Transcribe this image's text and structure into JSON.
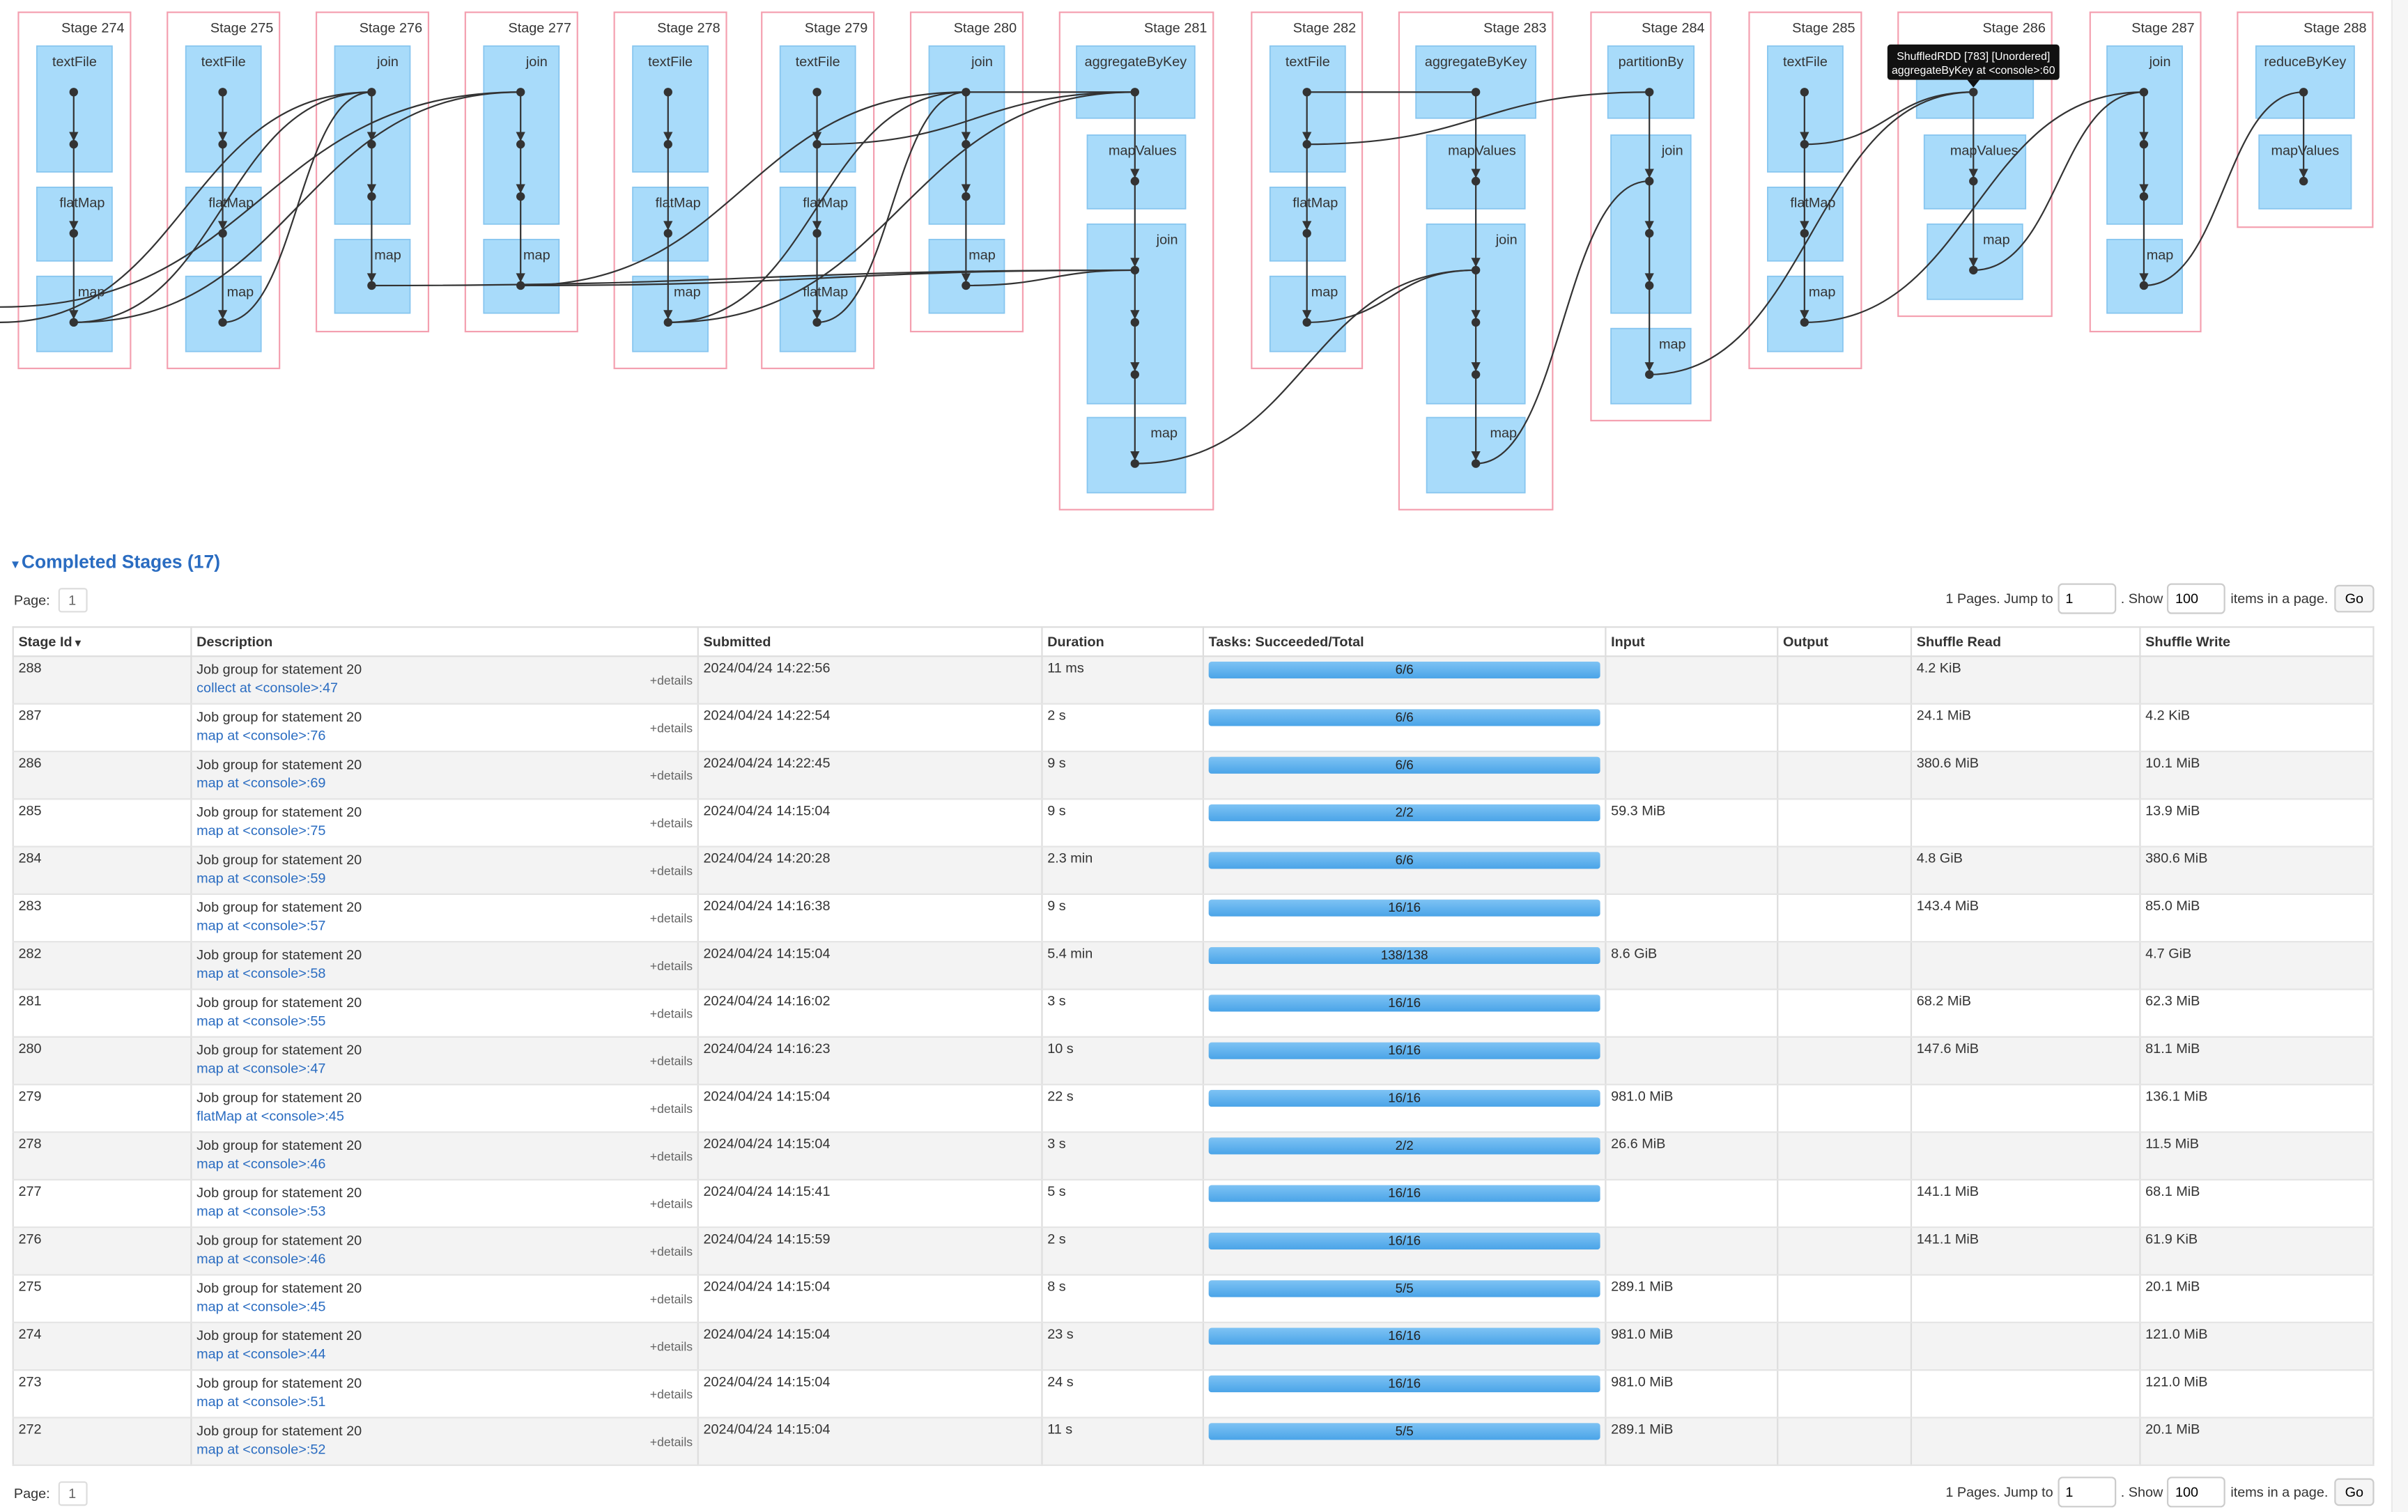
{
  "dag": {
    "stages": [
      {
        "label": "Stage 274",
        "rdds": [
          "textFile",
          "flatMap",
          "map"
        ]
      },
      {
        "label": "Stage 275",
        "rdds": [
          "textFile",
          "flatMap",
          "map"
        ]
      },
      {
        "label": "Stage 276",
        "rdds": [
          "join",
          "map"
        ]
      },
      {
        "label": "Stage 277",
        "rdds": [
          "join",
          "map"
        ]
      },
      {
        "label": "Stage 278",
        "rdds": [
          "textFile",
          "flatMap",
          "map"
        ]
      },
      {
        "label": "Stage 279",
        "rdds": [
          "textFile",
          "flatMap",
          "flatMap"
        ]
      },
      {
        "label": "Stage 280",
        "rdds": [
          "join",
          "map"
        ]
      },
      {
        "label": "Stage 281",
        "rdds": [
          "aggregateByKey",
          "mapValues",
          "join",
          "map"
        ]
      },
      {
        "label": "Stage 282",
        "rdds": [
          "textFile",
          "flatMap",
          "map"
        ]
      },
      {
        "label": "Stage 283",
        "rdds": [
          "aggregateByKey",
          "mapValues",
          "join",
          "map"
        ]
      },
      {
        "label": "Stage 284",
        "rdds": [
          "partitionBy",
          "join",
          "map"
        ]
      },
      {
        "label": "Stage 285",
        "rdds": [
          "textFile",
          "flatMap",
          "map"
        ]
      },
      {
        "label": "Stage 286",
        "rdds": [
          "",
          "mapValues",
          "map"
        ]
      },
      {
        "label": "Stage 287",
        "rdds": [
          "join",
          "map"
        ]
      },
      {
        "label": "Stage 288",
        "rdds": [
          "reduceByKey",
          "mapValues"
        ]
      }
    ],
    "tooltip": {
      "line1": "ShuffledRDD [783] [Unordered]",
      "line2": "aggregateByKey at <console>:60"
    }
  },
  "section": {
    "title": "Completed Stages (17)"
  },
  "pagination": {
    "page_label": "Page:",
    "current_page": "1",
    "pages_text": "1 Pages. Jump to",
    "jump_value": "1",
    "show_text": ". Show",
    "show_value": "100",
    "items_text": "items in a page.",
    "go_label": "Go"
  },
  "table": {
    "headers": [
      "Stage Id",
      "Description",
      "Submitted",
      "Duration",
      "Tasks: Succeeded/Total",
      "Input",
      "Output",
      "Shuffle Read",
      "Shuffle Write"
    ],
    "sort_indicator": "▾",
    "details_label": "+details",
    "rows": [
      {
        "id": "288",
        "job": "Job group for statement 20",
        "link": "collect at <console>:47",
        "submitted": "2024/04/24 14:22:56",
        "duration": "11 ms",
        "tasks": "6/6",
        "progress": 1,
        "input": "",
        "output": "",
        "shuffle_read": "4.2 KiB",
        "shuffle_write": ""
      },
      {
        "id": "287",
        "job": "Job group for statement 20",
        "link": "map at <console>:76",
        "submitted": "2024/04/24 14:22:54",
        "duration": "2 s",
        "tasks": "6/6",
        "progress": 1,
        "input": "",
        "output": "",
        "shuffle_read": "24.1 MiB",
        "shuffle_write": "4.2 KiB"
      },
      {
        "id": "286",
        "job": "Job group for statement 20",
        "link": "map at <console>:69",
        "submitted": "2024/04/24 14:22:45",
        "duration": "9 s",
        "tasks": "6/6",
        "progress": 1,
        "input": "",
        "output": "",
        "shuffle_read": "380.6 MiB",
        "shuffle_write": "10.1 MiB"
      },
      {
        "id": "285",
        "job": "Job group for statement 20",
        "link": "map at <console>:75",
        "submitted": "2024/04/24 14:15:04",
        "duration": "9 s",
        "tasks": "2/2",
        "progress": 1,
        "input": "59.3 MiB",
        "output": "",
        "shuffle_read": "",
        "shuffle_write": "13.9 MiB"
      },
      {
        "id": "284",
        "job": "Job group for statement 20",
        "link": "map at <console>:59",
        "submitted": "2024/04/24 14:20:28",
        "duration": "2.3 min",
        "tasks": "6/6",
        "progress": 1,
        "input": "",
        "output": "",
        "shuffle_read": "4.8 GiB",
        "shuffle_write": "380.6 MiB"
      },
      {
        "id": "283",
        "job": "Job group for statement 20",
        "link": "map at <console>:57",
        "submitted": "2024/04/24 14:16:38",
        "duration": "9 s",
        "tasks": "16/16",
        "progress": 1,
        "input": "",
        "output": "",
        "shuffle_read": "143.4 MiB",
        "shuffle_write": "85.0 MiB"
      },
      {
        "id": "282",
        "job": "Job group for statement 20",
        "link": "map at <console>:58",
        "submitted": "2024/04/24 14:15:04",
        "duration": "5.4 min",
        "tasks": "138/138",
        "progress": 1,
        "input": "8.6 GiB",
        "output": "",
        "shuffle_read": "",
        "shuffle_write": "4.7 GiB"
      },
      {
        "id": "281",
        "job": "Job group for statement 20",
        "link": "map at <console>:55",
        "submitted": "2024/04/24 14:16:02",
        "duration": "3 s",
        "tasks": "16/16",
        "progress": 1,
        "input": "",
        "output": "",
        "shuffle_read": "68.2 MiB",
        "shuffle_write": "62.3 MiB"
      },
      {
        "id": "280",
        "job": "Job group for statement 20",
        "link": "map at <console>:47",
        "submitted": "2024/04/24 14:16:23",
        "duration": "10 s",
        "tasks": "16/16",
        "progress": 1,
        "input": "",
        "output": "",
        "shuffle_read": "147.6 MiB",
        "shuffle_write": "81.1 MiB"
      },
      {
        "id": "279",
        "job": "Job group for statement 20",
        "link": "flatMap at <console>:45",
        "submitted": "2024/04/24 14:15:04",
        "duration": "22 s",
        "tasks": "16/16",
        "progress": 1,
        "input": "981.0 MiB",
        "output": "",
        "shuffle_read": "",
        "shuffle_write": "136.1 MiB"
      },
      {
        "id": "278",
        "job": "Job group for statement 20",
        "link": "map at <console>:46",
        "submitted": "2024/04/24 14:15:04",
        "duration": "3 s",
        "tasks": "2/2",
        "progress": 1,
        "input": "26.6 MiB",
        "output": "",
        "shuffle_read": "",
        "shuffle_write": "11.5 MiB"
      },
      {
        "id": "277",
        "job": "Job group for statement 20",
        "link": "map at <console>:53",
        "submitted": "2024/04/24 14:15:41",
        "duration": "5 s",
        "tasks": "16/16",
        "progress": 1,
        "input": "",
        "output": "",
        "shuffle_read": "141.1 MiB",
        "shuffle_write": "68.1 MiB"
      },
      {
        "id": "276",
        "job": "Job group for statement 20",
        "link": "map at <console>:46",
        "submitted": "2024/04/24 14:15:59",
        "duration": "2 s",
        "tasks": "16/16",
        "progress": 1,
        "input": "",
        "output": "",
        "shuffle_read": "141.1 MiB",
        "shuffle_write": "61.9 KiB"
      },
      {
        "id": "275",
        "job": "Job group for statement 20",
        "link": "map at <console>:45",
        "submitted": "2024/04/24 14:15:04",
        "duration": "8 s",
        "tasks": "5/5",
        "progress": 1,
        "input": "289.1 MiB",
        "output": "",
        "shuffle_read": "",
        "shuffle_write": "20.1 MiB"
      },
      {
        "id": "274",
        "job": "Job group for statement 20",
        "link": "map at <console>:44",
        "submitted": "2024/04/24 14:15:04",
        "duration": "23 s",
        "tasks": "16/16",
        "progress": 1,
        "input": "981.0 MiB",
        "output": "",
        "shuffle_read": "",
        "shuffle_write": "121.0 MiB"
      },
      {
        "id": "273",
        "job": "Job group for statement 20",
        "link": "map at <console>:51",
        "submitted": "2024/04/24 14:15:04",
        "duration": "24 s",
        "tasks": "16/16",
        "progress": 1,
        "input": "981.0 MiB",
        "output": "",
        "shuffle_read": "",
        "shuffle_write": "121.0 MiB"
      },
      {
        "id": "272",
        "job": "Job group for statement 20",
        "link": "map at <console>:52",
        "submitted": "2024/04/24 14:15:04",
        "duration": "11 s",
        "tasks": "5/5",
        "progress": 1,
        "input": "289.1 MiB",
        "output": "",
        "shuffle_read": "",
        "shuffle_write": "20.1 MiB"
      }
    ]
  }
}
